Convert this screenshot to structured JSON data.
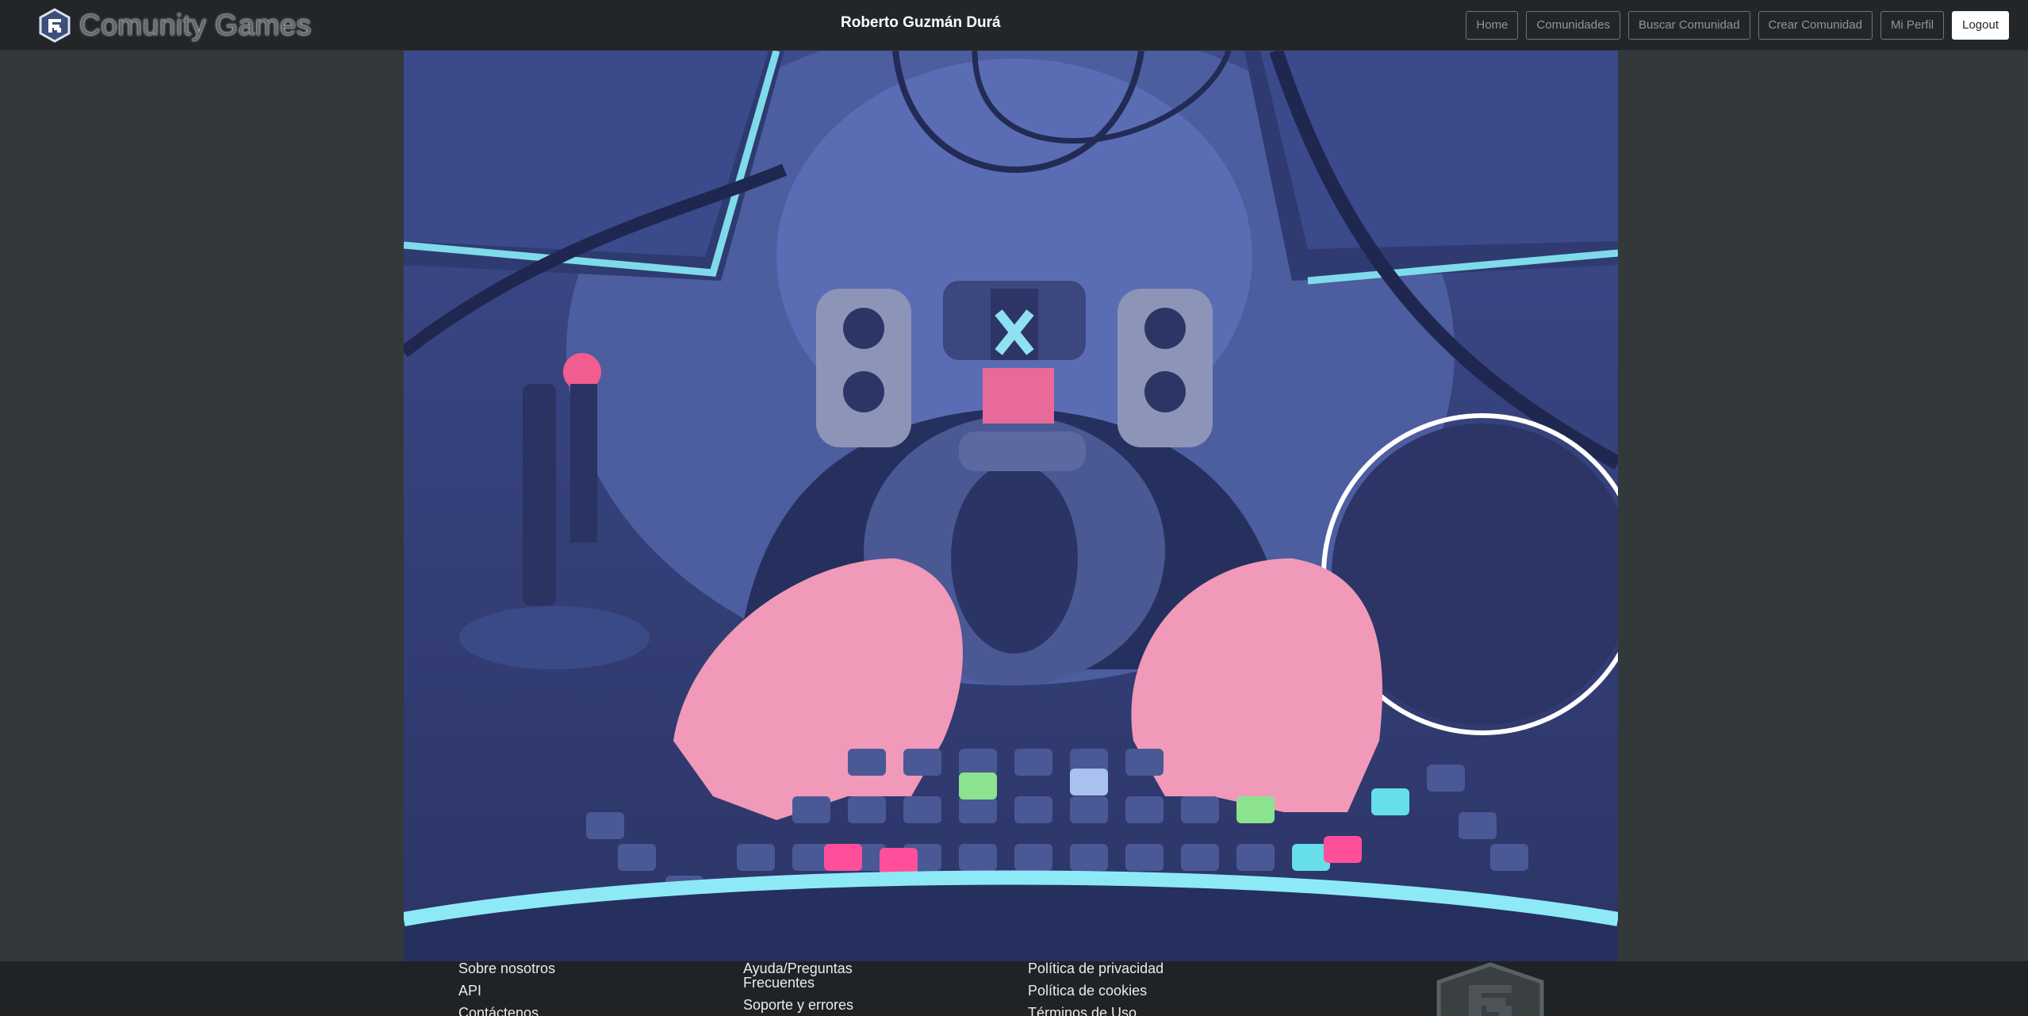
{
  "navbar": {
    "brand": "Comunity Games",
    "user_name": "Roberto Guzmán Durá",
    "buttons": [
      {
        "label": "Home"
      },
      {
        "label": "Comunidades"
      },
      {
        "label": "Buscar Comunidad"
      },
      {
        "label": "Crear Comunidad"
      },
      {
        "label": "Mi Perfil"
      },
      {
        "label": "Logout"
      }
    ]
  },
  "hero": {
    "icon": "vr-gamer-illustration"
  },
  "footer": {
    "col1": [
      "Sobre nosotros",
      "API",
      "Contáctenos"
    ],
    "col2": [
      "Ayuda/Preguntas Frecuentes",
      "Soporte y errores"
    ],
    "col3": [
      "Política de privacidad",
      "Política de cookies",
      "Términos de Uso"
    ]
  },
  "colors": {
    "navbar_bg": "#222629",
    "page_bg": "#33383b",
    "footer_bg": "#1f2325",
    "hero_bg": "#36437d",
    "accent_cyan": "#7fdbea",
    "accent_pink": "#e86a9a"
  }
}
